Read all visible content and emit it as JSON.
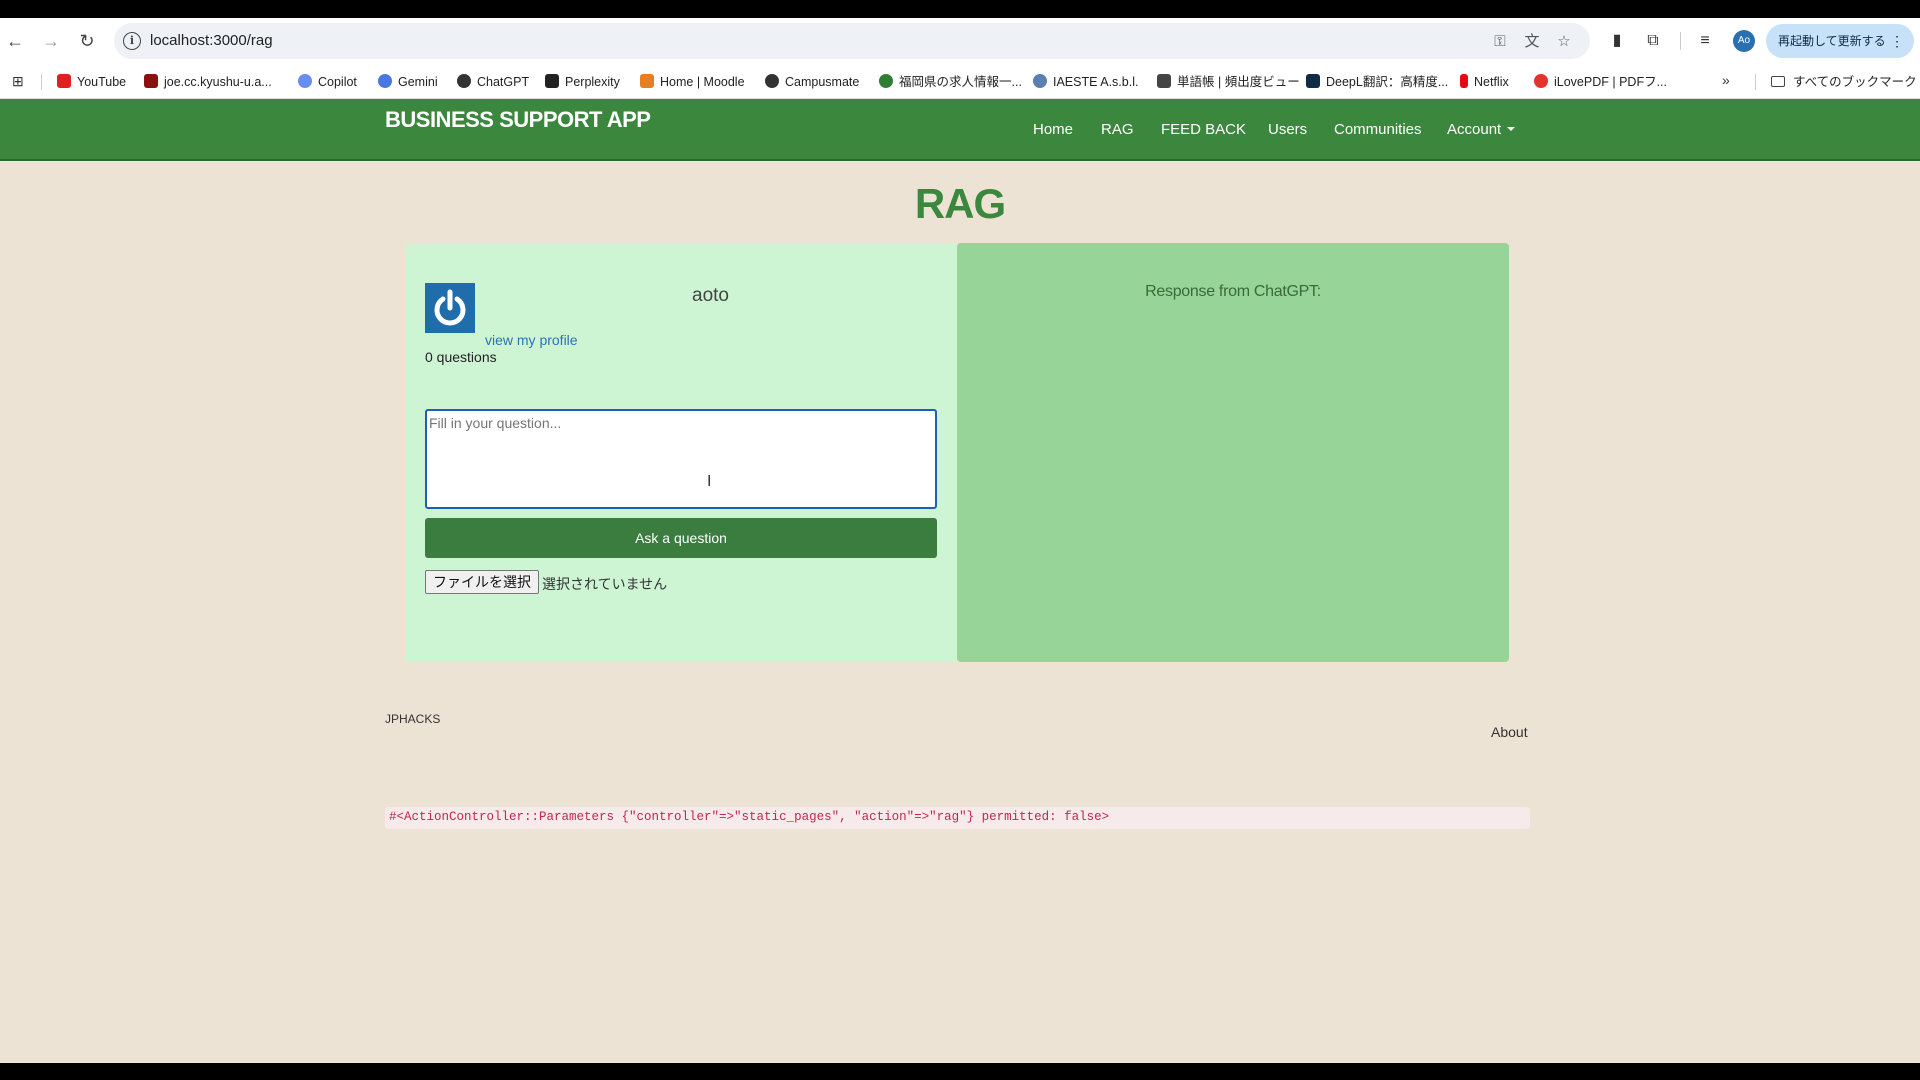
{
  "browser": {
    "url": "localhost:3000/rag",
    "profile_initials": "Ao",
    "restart_label": "再起動して更新する",
    "bookmarks": [
      {
        "label": "YouTube",
        "color": "#e02020"
      },
      {
        "label": "joe.cc.kyushu-u.a...",
        "color": "#8b1010"
      },
      {
        "label": "Copilot",
        "color": "#6a8cf0"
      },
      {
        "label": "Gemini",
        "color": "#4a78e0"
      },
      {
        "label": "ChatGPT",
        "color": "#333333"
      },
      {
        "label": "Perplexity",
        "color": "#222222"
      },
      {
        "label": "Home | Moodle",
        "color": "#e67e22"
      },
      {
        "label": "Campusmate",
        "color": "#333333"
      },
      {
        "label": "福岡県の求人情報一...",
        "color": "#2e7d32"
      },
      {
        "label": "IAESTE A.s.b.l.",
        "color": "#5a7fb0"
      },
      {
        "label": "単語帳 | 頻出度ビュー",
        "color": "#444444"
      },
      {
        "label": "DeepL翻訳：高精度...",
        "color": "#0f2b46"
      },
      {
        "label": "Netflix",
        "color": "#e50914"
      },
      {
        "label": "iLovePDF | PDFフ...",
        "color": "#e5322d"
      }
    ],
    "all_bookmarks_label": "すべてのブックマーク"
  },
  "navbar": {
    "brand": "BUSINESS SUPPORT APP",
    "links": [
      "Home",
      "RAG",
      "FEED BACK",
      "Users",
      "Communities",
      "Account"
    ]
  },
  "page": {
    "title": "RAG",
    "user": {
      "name": "aoto",
      "profile_link": "view my profile",
      "question_count": "0 questions"
    },
    "question_placeholder": "Fill in your question...",
    "ask_button": "Ask a question",
    "file_button": "ファイルを選択",
    "file_status": "選択されていません",
    "response_label": "Response from ChatGPT:"
  },
  "footer": {
    "left": "JPHACKS",
    "about": "About"
  },
  "debug": "#<ActionController::Parameters {\"controller\"=>\"static_pages\", \"action\"=>\"rag\"} permitted: false>",
  "colors": {
    "navbar": "#3b873e",
    "page_bg": "#ede3d5",
    "left_panel": "#cef5d3",
    "right_panel": "#97d497",
    "button": "#3b7d3e"
  }
}
